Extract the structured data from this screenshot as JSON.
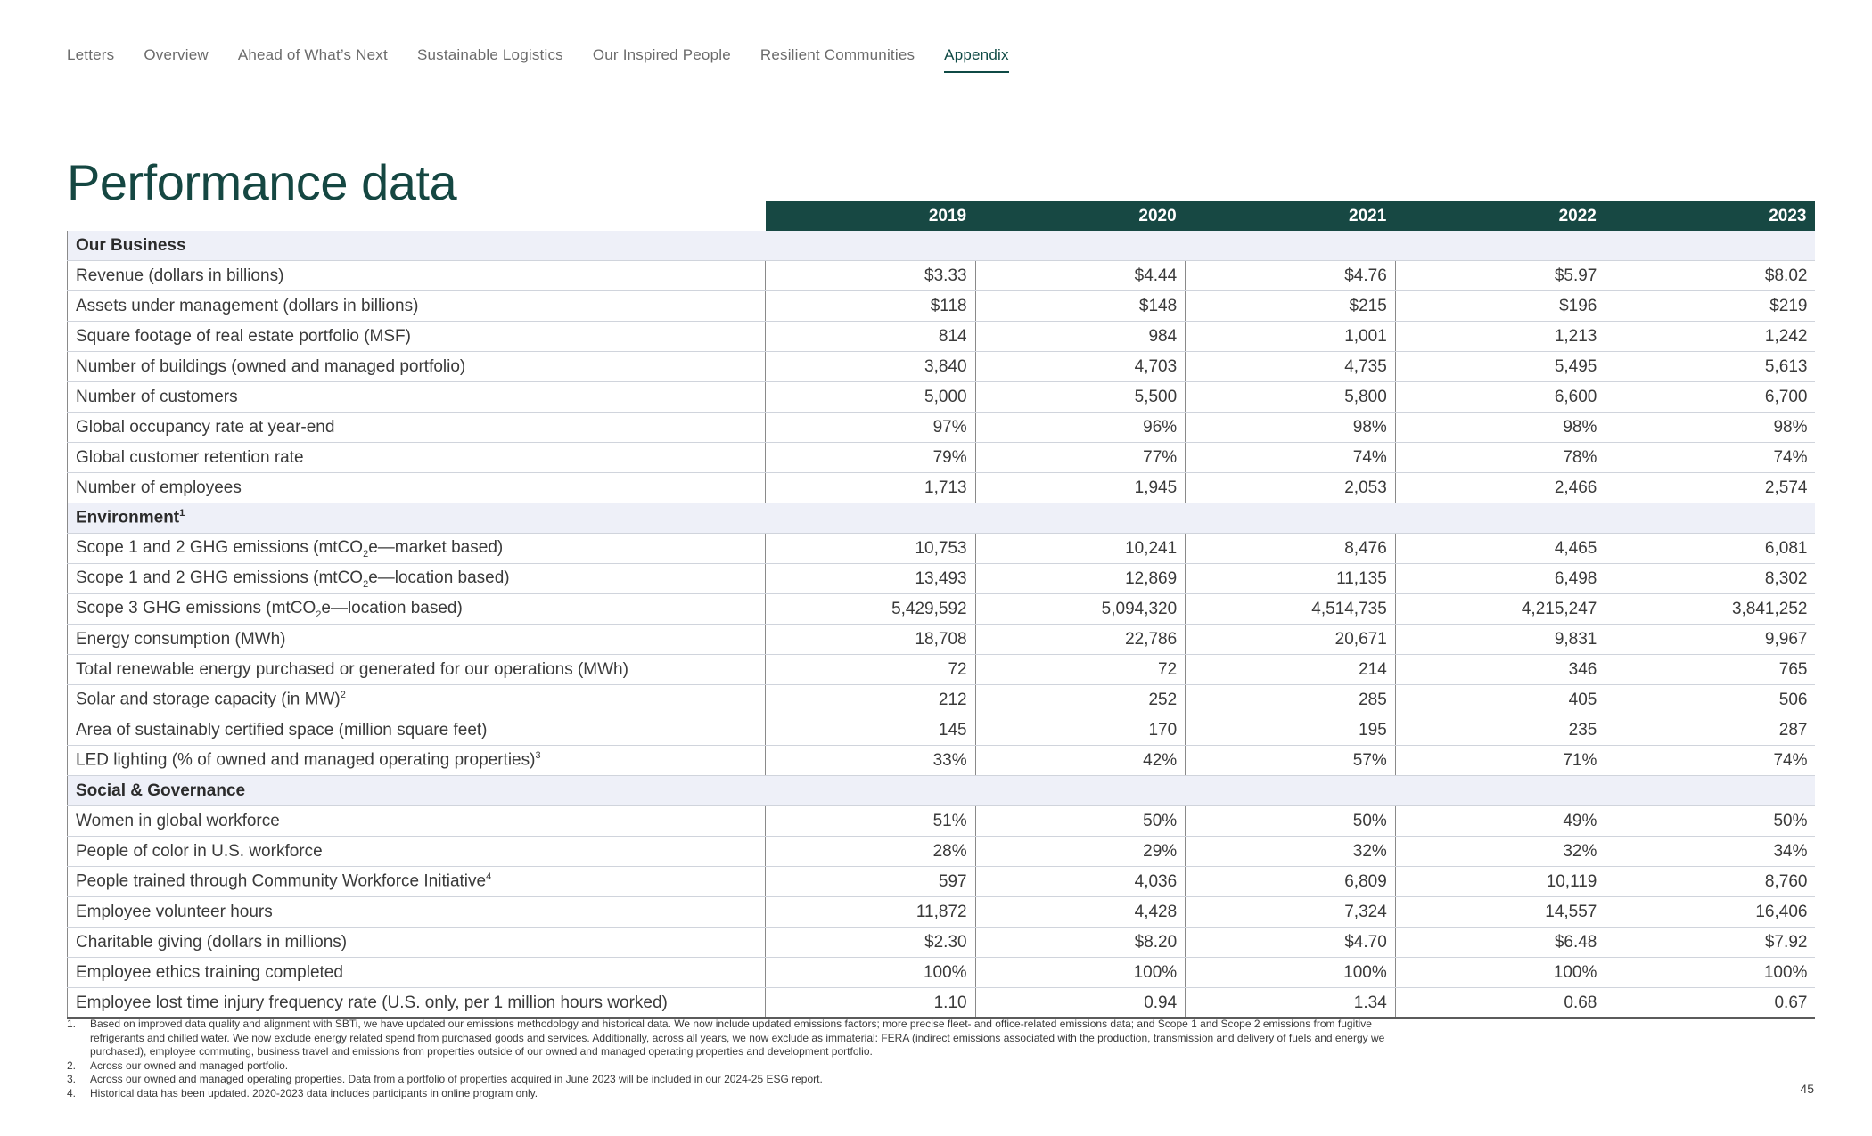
{
  "nav": {
    "items": [
      "Letters",
      "Overview",
      "Ahead of What’s Next",
      "Sustainable Logistics",
      "Our Inspired People",
      "Resilient Communities",
      "Appendix"
    ],
    "active_index": 6
  },
  "page_title": "Performance data",
  "table": {
    "years": [
      "2019",
      "2020",
      "2021",
      "2022",
      "2023"
    ],
    "sections": [
      {
        "title": "Our Business",
        "title_sup": "",
        "rows": [
          {
            "label": "Revenue (dollars in billions)",
            "values": [
              "$3.33",
              "$4.44",
              "$4.76",
              "$5.97",
              "$8.02"
            ]
          },
          {
            "label": "Assets under management (dollars in billions)",
            "values": [
              "$118",
              "$148",
              "$215",
              "$196",
              "$219"
            ]
          },
          {
            "label": "Square footage of real estate portfolio (MSF)",
            "values": [
              "814",
              "984",
              "1,001",
              "1,213",
              "1,242"
            ]
          },
          {
            "label": "Number of buildings (owned and managed portfolio)",
            "values": [
              "3,840",
              "4,703",
              "4,735",
              "5,495",
              "5,613"
            ]
          },
          {
            "label": "Number of customers",
            "values": [
              "5,000",
              "5,500",
              "5,800",
              "6,600",
              "6,700"
            ]
          },
          {
            "label": "Global occupancy rate at year-end",
            "values": [
              "97%",
              "96%",
              "98%",
              "98%",
              "98%"
            ]
          },
          {
            "label": "Global customer retention rate",
            "values": [
              "79%",
              "77%",
              "74%",
              "78%",
              "74%"
            ]
          },
          {
            "label": "Number of employees",
            "values": [
              "1,713",
              "1,945",
              "2,053",
              "2,466",
              "2,574"
            ]
          }
        ]
      },
      {
        "title": "Environment",
        "title_sup": "1",
        "rows": [
          {
            "label_parts": [
              "Scope 1 and 2 GHG emissions (mtCO",
              "2",
              "e—market based)"
            ],
            "values": [
              "10,753",
              "10,241",
              "8,476",
              "4,465",
              "6,081"
            ]
          },
          {
            "label_parts": [
              "Scope 1 and 2 GHG emissions (mtCO",
              "2",
              "e—location based)"
            ],
            "values": [
              "13,493",
              "12,869",
              "11,135",
              "6,498",
              "8,302"
            ]
          },
          {
            "label_parts": [
              "Scope 3 GHG emissions (mtCO",
              "2",
              "e—location based)"
            ],
            "values": [
              "5,429,592",
              "5,094,320",
              "4,514,735",
              "4,215,247",
              "3,841,252"
            ]
          },
          {
            "label": "Energy consumption (MWh)",
            "values": [
              "18,708",
              "22,786",
              "20,671",
              "9,831",
              "9,967"
            ]
          },
          {
            "label": "Total renewable energy purchased or generated for our operations (MWh)",
            "values": [
              "72",
              "72",
              "214",
              "346",
              "765"
            ]
          },
          {
            "label": "Solar and storage capacity (in MW)",
            "sup": "2",
            "values": [
              "212",
              "252",
              "285",
              "405",
              "506"
            ]
          },
          {
            "label": "Area of sustainably certified space (million square feet)",
            "values": [
              "145",
              "170",
              "195",
              "235",
              "287"
            ]
          },
          {
            "label": "LED lighting (% of owned and managed operating properties)",
            "sup": "3",
            "values": [
              "33%",
              "42%",
              "57%",
              "71%",
              "74%"
            ]
          }
        ]
      },
      {
        "title": "Social & Governance",
        "title_sup": "",
        "rows": [
          {
            "label": "Women in global workforce",
            "values": [
              "51%",
              "50%",
              "50%",
              "49%",
              "50%"
            ]
          },
          {
            "label": "People of color in U.S. workforce",
            "values": [
              "28%",
              "29%",
              "32%",
              "32%",
              "34%"
            ]
          },
          {
            "label": "People trained through Community Workforce Initiative",
            "sup": "4",
            "values": [
              "597",
              "4,036",
              "6,809",
              "10,119",
              "8,760"
            ]
          },
          {
            "label": "Employee volunteer hours",
            "values": [
              "11,872",
              "4,428",
              "7,324",
              "14,557",
              "16,406"
            ]
          },
          {
            "label": "Charitable giving (dollars in millions)",
            "values": [
              "$2.30",
              "$8.20",
              "$4.70",
              "$6.48",
              "$7.92"
            ]
          },
          {
            "label": "Employee ethics training completed",
            "values": [
              "100%",
              "100%",
              "100%",
              "100%",
              "100%"
            ]
          },
          {
            "label": "Employee lost time injury frequency rate (U.S. only, per 1 million hours worked)",
            "values": [
              "1.10",
              "0.94",
              "1.34",
              "0.68",
              "0.67"
            ]
          }
        ]
      }
    ]
  },
  "footnotes": [
    {
      "num": "1.",
      "text": "Based on improved data quality and alignment with SBTi, we have updated our emissions methodology and historical data. We now include updated emissions factors; more precise fleet- and office-related emissions data; and Scope 1 and Scope 2 emissions from fugitive refrigerants and chilled water. We now exclude energy related spend from purchased goods and services. Additionally, across all years, we now exclude as immaterial: FERA (indirect emissions associated with the production, transmission and delivery of fuels and energy we purchased), employee commuting, business travel and emissions from properties outside of our owned and managed operating properties and development portfolio."
    },
    {
      "num": "2.",
      "text": "Across our owned and managed portfolio."
    },
    {
      "num": "3.",
      "text": "Across our owned and managed operating properties. Data from a portfolio of properties acquired in June 2023 will be included in our 2024-25 ESG report."
    },
    {
      "num": "4.",
      "text": "Historical data has been updated. 2020-2023 data includes participants in online program only."
    }
  ],
  "page_number": "45"
}
